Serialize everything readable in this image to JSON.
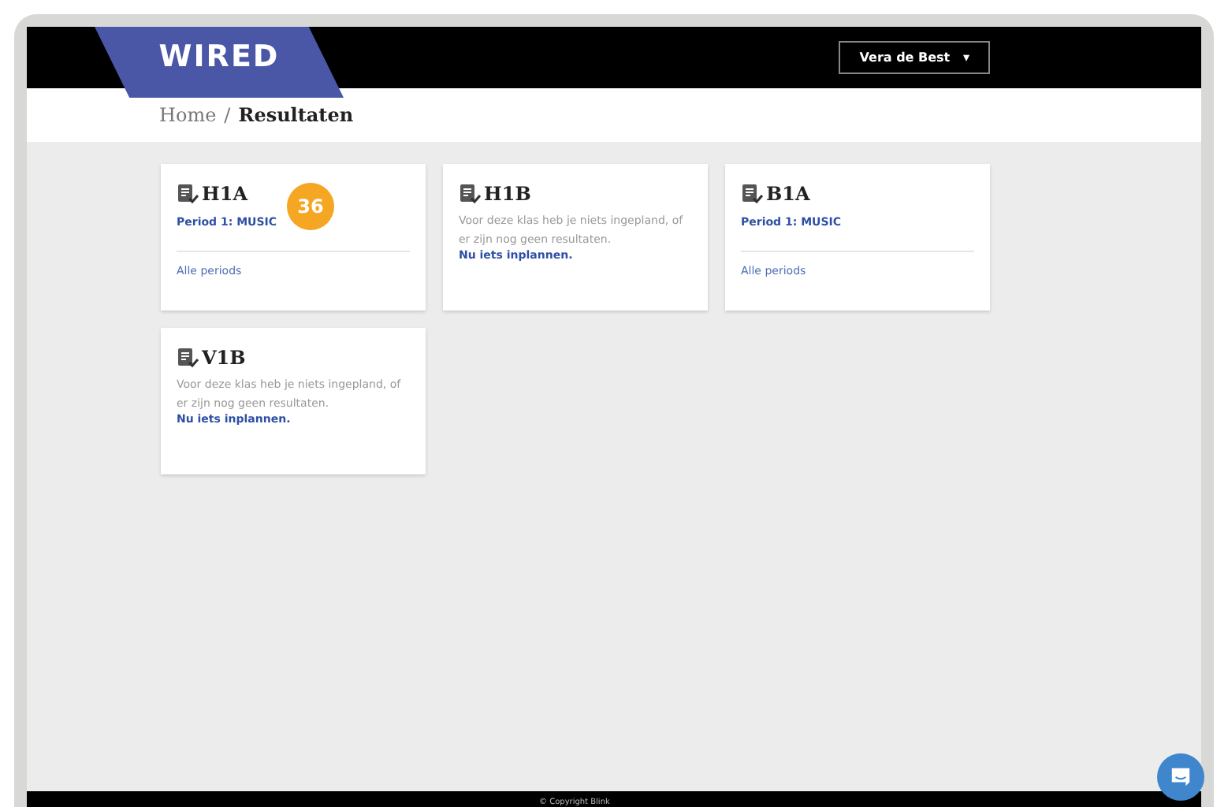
{
  "header": {
    "logo": "WIRED",
    "user_menu": {
      "label": "Vera de Best",
      "caret": "▾"
    }
  },
  "breadcrumb_separator": "/",
  "breadcrumb": [
    {
      "label": "Home",
      "current": false
    },
    {
      "label": "Resultaten",
      "current": true
    }
  ],
  "cards": [
    {
      "kind": "results",
      "title": "H1A",
      "period": "Period 1: MUSIC",
      "all_link": "Alle periods",
      "badge": "36"
    },
    {
      "kind": "empty",
      "title": "H1B",
      "message": "Voor deze klas heb je niets ingepland, of er zijn nog geen resultaten.",
      "action": "Nu iets inplannen."
    },
    {
      "kind": "results",
      "title": "B1A",
      "period": "Period 1: MUSIC",
      "all_link": "Alle periods"
    },
    {
      "kind": "empty",
      "title": "V1B",
      "message": "Voor deze klas heb je niets ingepland, of er zijn nog geen resultaten.",
      "action": "Nu iets inplannen."
    }
  ],
  "footer": {
    "copyright": "© Copyright Blink"
  }
}
